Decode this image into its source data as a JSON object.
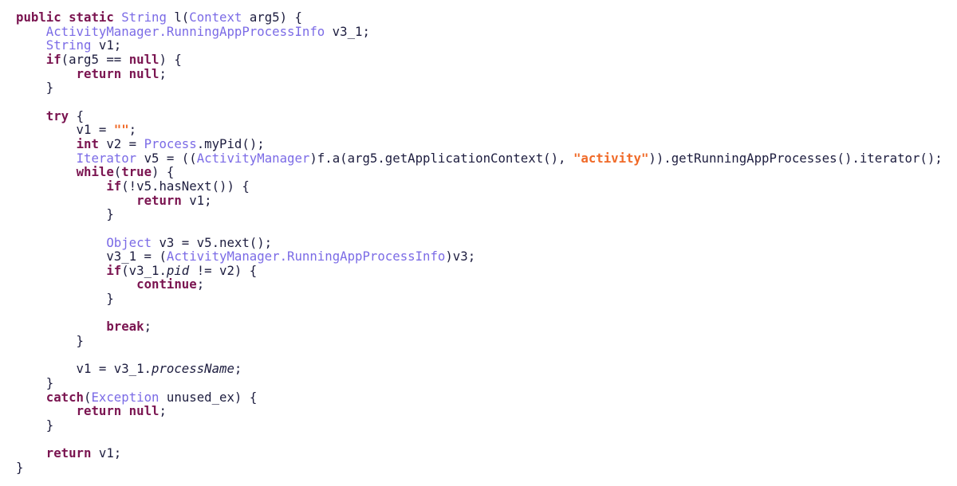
{
  "colors": {
    "keyword": "#7a1450",
    "type": "#7b6be6",
    "string": "#f06a28",
    "plain": "#1d1d3f",
    "background": "#ffffff"
  },
  "code_lines": [
    [
      [
        "kw",
        "public static "
      ],
      [
        "ty",
        "String"
      ],
      [
        "pl",
        " l("
      ],
      [
        "ty",
        "Context"
      ],
      [
        "pl",
        " arg5) {"
      ]
    ],
    [
      [
        "pl",
        "    "
      ],
      [
        "ty",
        "ActivityManager.RunningAppProcessInfo"
      ],
      [
        "pl",
        " v3_1;"
      ]
    ],
    [
      [
        "pl",
        "    "
      ],
      [
        "ty",
        "String"
      ],
      [
        "pl",
        " v1;"
      ]
    ],
    [
      [
        "pl",
        "    "
      ],
      [
        "kw",
        "if"
      ],
      [
        "pl",
        "(arg5 == "
      ],
      [
        "kw",
        "null"
      ],
      [
        "pl",
        ") {"
      ]
    ],
    [
      [
        "pl",
        "        "
      ],
      [
        "kw",
        "return null"
      ],
      [
        "pl",
        ";"
      ]
    ],
    [
      [
        "pl",
        "    }"
      ]
    ],
    [],
    [
      [
        "pl",
        "    "
      ],
      [
        "kw",
        "try"
      ],
      [
        "pl",
        " {"
      ]
    ],
    [
      [
        "pl",
        "        v1 = "
      ],
      [
        "str",
        "\"\""
      ],
      [
        "pl",
        ";"
      ]
    ],
    [
      [
        "pl",
        "        "
      ],
      [
        "kw",
        "int"
      ],
      [
        "pl",
        " v2 = "
      ],
      [
        "ty",
        "Process"
      ],
      [
        "pl",
        ".myPid();"
      ]
    ],
    [
      [
        "pl",
        "        "
      ],
      [
        "ty",
        "Iterator"
      ],
      [
        "pl",
        " v5 = (("
      ],
      [
        "ty",
        "ActivityManager"
      ],
      [
        "pl",
        ")f.a(arg5.getApplicationContext(), "
      ],
      [
        "str",
        "\"activity\""
      ],
      [
        "pl",
        ")).getRunningAppProcesses().iterator();"
      ]
    ],
    [
      [
        "pl",
        "        "
      ],
      [
        "kw",
        "while"
      ],
      [
        "pl",
        "("
      ],
      [
        "kw",
        "true"
      ],
      [
        "pl",
        ") {"
      ]
    ],
    [
      [
        "pl",
        "            "
      ],
      [
        "kw",
        "if"
      ],
      [
        "pl",
        "(!v5.hasNext()) {"
      ]
    ],
    [
      [
        "pl",
        "                "
      ],
      [
        "kw",
        "return"
      ],
      [
        "pl",
        " v1;"
      ]
    ],
    [
      [
        "pl",
        "            }"
      ]
    ],
    [],
    [
      [
        "pl",
        "            "
      ],
      [
        "ty",
        "Object"
      ],
      [
        "pl",
        " v3 = v5.next();"
      ]
    ],
    [
      [
        "pl",
        "            v3_1 = ("
      ],
      [
        "ty",
        "ActivityManager.RunningAppProcessInfo"
      ],
      [
        "pl",
        ")v3;"
      ]
    ],
    [
      [
        "pl",
        "            "
      ],
      [
        "kw",
        "if"
      ],
      [
        "pl",
        "(v3_1."
      ],
      [
        "fld",
        "pid"
      ],
      [
        "pl",
        " != v2) {"
      ]
    ],
    [
      [
        "pl",
        "                "
      ],
      [
        "kw",
        "continue"
      ],
      [
        "pl",
        ";"
      ]
    ],
    [
      [
        "pl",
        "            }"
      ]
    ],
    [],
    [
      [
        "pl",
        "            "
      ],
      [
        "kw",
        "break"
      ],
      [
        "pl",
        ";"
      ]
    ],
    [
      [
        "pl",
        "        }"
      ]
    ],
    [],
    [
      [
        "pl",
        "        v1 = v3_1."
      ],
      [
        "fld",
        "processName"
      ],
      [
        "pl",
        ";"
      ]
    ],
    [
      [
        "pl",
        "    }"
      ]
    ],
    [
      [
        "pl",
        "    "
      ],
      [
        "kw",
        "catch"
      ],
      [
        "pl",
        "("
      ],
      [
        "ty",
        "Exception"
      ],
      [
        "pl",
        " unused_ex) {"
      ]
    ],
    [
      [
        "pl",
        "        "
      ],
      [
        "kw",
        "return null"
      ],
      [
        "pl",
        ";"
      ]
    ],
    [
      [
        "pl",
        "    }"
      ]
    ],
    [],
    [
      [
        "pl",
        "    "
      ],
      [
        "kw",
        "return"
      ],
      [
        "pl",
        " v1;"
      ]
    ],
    [
      [
        "pl",
        "}"
      ]
    ]
  ]
}
